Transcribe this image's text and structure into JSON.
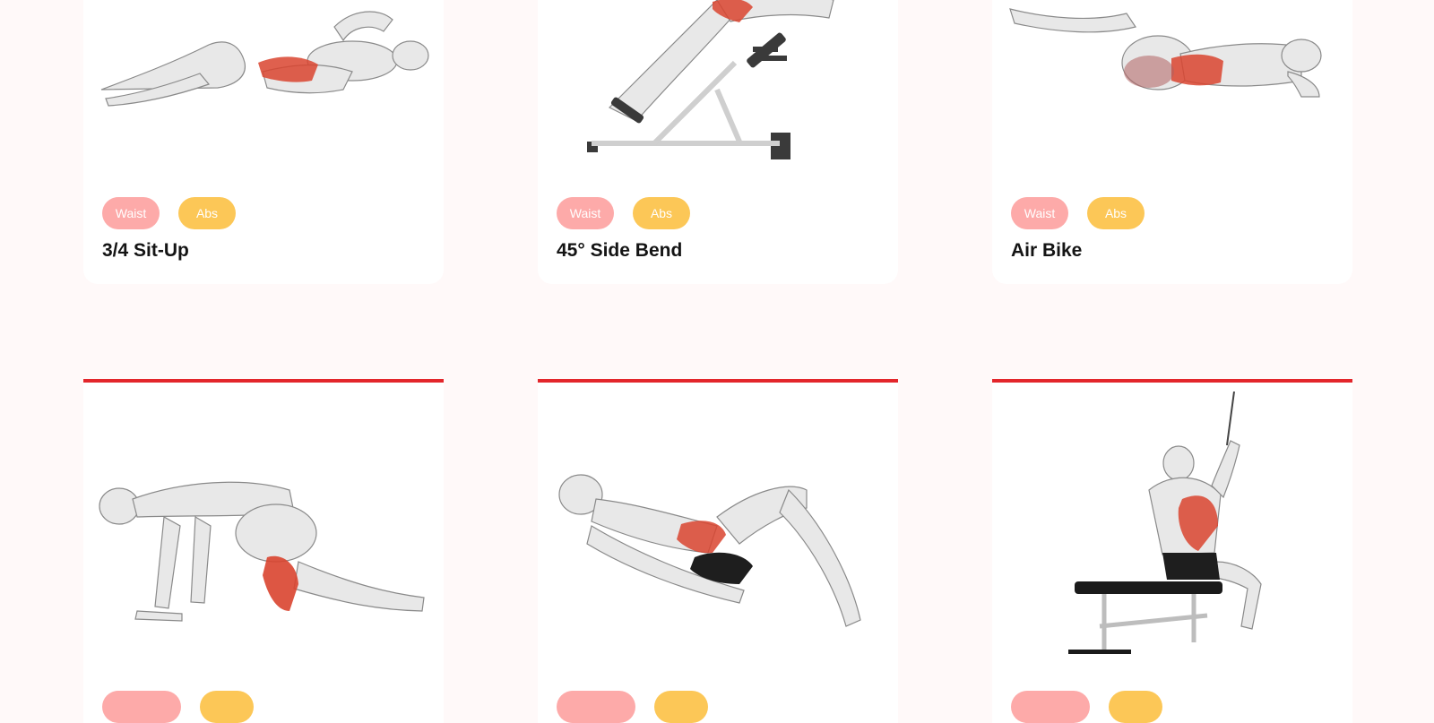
{
  "exercises": [
    {
      "name": "3/4 Sit-Up",
      "tags": [
        "Waist",
        "Abs"
      ]
    },
    {
      "name": "45° Side Bend",
      "tags": [
        "Waist",
        "Abs"
      ]
    },
    {
      "name": "Air Bike",
      "tags": [
        "Waist",
        "Abs"
      ]
    },
    {
      "name": "",
      "tags": [
        "",
        ""
      ]
    },
    {
      "name": "",
      "tags": [
        "",
        ""
      ]
    },
    {
      "name": "",
      "tags": [
        "",
        ""
      ]
    }
  ],
  "colors": {
    "page_bg": "#fff9f9",
    "card_bg": "#ffffff",
    "accent_line": "#e3262b",
    "tag_waist": "#fdaaa9",
    "tag_abs": "#fcc757",
    "muscle_highlight": "#d9442f"
  },
  "icons": [
    "situp-figure",
    "side-bend-figure",
    "air-bike-figure",
    "kneeling-figure",
    "glute-bridge-figure",
    "cable-pulldown-figure"
  ]
}
